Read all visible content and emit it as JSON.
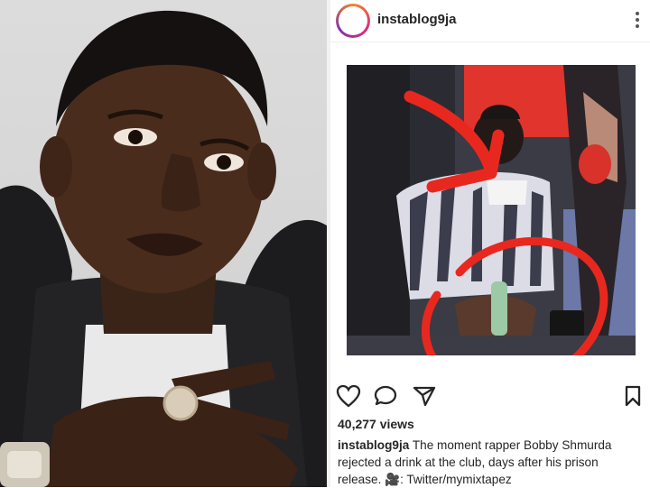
{
  "post": {
    "username": "instablog9ja",
    "avatar_text": "instablog9ja",
    "views": "40,277 views",
    "caption_user": "instablog9ja",
    "caption_text": " The moment rapper Bobby Shmurda rejected a drink at the club, days after his prison release. 🎥: Twitter/mymixtapez"
  },
  "icons": {
    "like": "heart-icon",
    "comment": "comment-icon",
    "share": "share-icon",
    "save": "bookmark-icon",
    "more": "more-vertical-icon"
  },
  "colors": {
    "annotation_red": "#e8281f",
    "stage_red": "#e0342c",
    "text": "#262626"
  }
}
